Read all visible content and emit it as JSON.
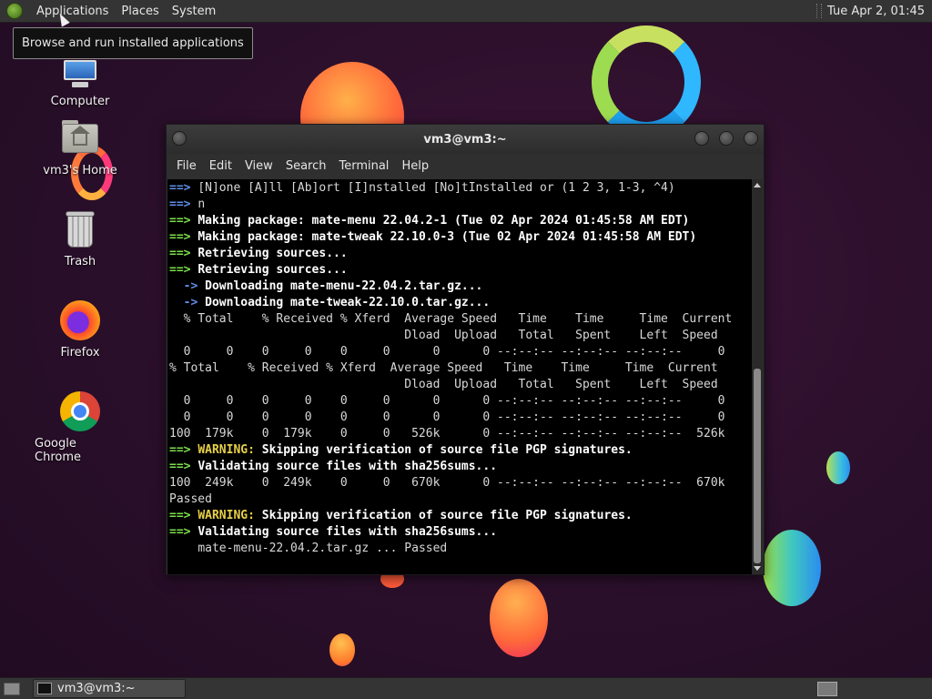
{
  "top_panel": {
    "menus": [
      "Applications",
      "Places",
      "System"
    ],
    "clock": "Tue Apr  2, 01:45",
    "logo_icon": "mate-logo-icon"
  },
  "tooltip": "Browse and run installed applications",
  "desktop_icons": [
    {
      "label": "Computer",
      "icon": "computer-icon"
    },
    {
      "label": "vm3's Home",
      "icon": "home-folder-icon"
    },
    {
      "label": "Trash",
      "icon": "trash-icon"
    },
    {
      "label": "Firefox",
      "icon": "firefox-icon"
    },
    {
      "label": "Google Chrome",
      "icon": "chrome-icon"
    }
  ],
  "terminal": {
    "title": "vm3@vm3:~",
    "menu": [
      "File",
      "Edit",
      "View",
      "Search",
      "Terminal",
      "Help"
    ],
    "lines": [
      {
        "p": "==> ",
        "pc": "bl",
        "t": "[N]one [A]ll [Ab]ort [I]nstalled [No]tInstalled or (1 2 3, 1-3, ^4)",
        "tc": ""
      },
      {
        "p": "==> ",
        "pc": "bl",
        "t": "n",
        "tc": ""
      },
      {
        "p": "==> ",
        "pc": "g",
        "t": "Making package: mate-menu 22.04.2-1 (Tue 02 Apr 2024 01:45:58 AM EDT)",
        "tc": "w"
      },
      {
        "p": "==> ",
        "pc": "g",
        "t": "Making package: mate-tweak 22.10.0-3 (Tue 02 Apr 2024 01:45:58 AM EDT)",
        "tc": "w"
      },
      {
        "p": "==> ",
        "pc": "g",
        "t": "Retrieving sources...",
        "tc": "w"
      },
      {
        "p": "==> ",
        "pc": "g",
        "t": "Retrieving sources...",
        "tc": "w"
      },
      {
        "p": "  -> ",
        "pc": "bl",
        "t": "Downloading mate-menu-22.04.2.tar.gz...",
        "tc": "w"
      },
      {
        "p": "  -> ",
        "pc": "bl",
        "t": "Downloading mate-tweak-22.10.0.tar.gz...",
        "tc": "w"
      },
      {
        "p": "",
        "pc": "",
        "t": "  % Total    % Received % Xferd  Average Speed   Time    Time     Time  Current",
        "tc": ""
      },
      {
        "p": "",
        "pc": "",
        "t": "                                 Dload  Upload   Total   Spent    Left  Speed",
        "tc": ""
      },
      {
        "p": "",
        "pc": "",
        "t": "  0     0    0     0    0     0      0      0 --:--:-- --:--:-- --:--:--     0",
        "tc": ""
      },
      {
        "p": "",
        "pc": "",
        "t": "% Total    % Received % Xferd  Average Speed   Time    Time     Time  Current",
        "tc": ""
      },
      {
        "p": "",
        "pc": "",
        "t": "                                 Dload  Upload   Total   Spent    Left  Speed",
        "tc": ""
      },
      {
        "p": "",
        "pc": "",
        "t": "  0     0    0     0    0     0      0      0 --:--:-- --:--:-- --:--:--     0",
        "tc": ""
      },
      {
        "p": "",
        "pc": "",
        "t": "  0     0    0     0    0     0      0      0 --:--:-- --:--:-- --:--:--     0",
        "tc": ""
      },
      {
        "p": "",
        "pc": "",
        "t": "100  179k    0  179k    0     0   526k      0 --:--:-- --:--:-- --:--:--  526k",
        "tc": ""
      },
      {
        "p": "==> ",
        "pc": "g",
        "t": "WARNING: ",
        "tc": "y",
        "t2": "Skipping verification of source file PGP signatures.",
        "tc2": "w"
      },
      {
        "p": "==> ",
        "pc": "g",
        "t": "Validating source files with sha256sums...",
        "tc": "w"
      },
      {
        "p": "",
        "pc": "",
        "t": "100  249k    0  249k    0     0   670k      0 --:--:-- --:--:-- --:--:--  670k",
        "tc": ""
      },
      {
        "p": "",
        "pc": "",
        "t": "Passed",
        "tc": ""
      },
      {
        "p": "==> ",
        "pc": "g",
        "t": "WARNING: ",
        "tc": "y",
        "t2": "Skipping verification of source file PGP signatures.",
        "tc2": "w"
      },
      {
        "p": "==> ",
        "pc": "g",
        "t": "Validating source files with sha256sums...",
        "tc": "w"
      },
      {
        "p": "    ",
        "pc": "",
        "t": "mate-menu-22.04.2.tar.gz ... Passed",
        "tc": ""
      }
    ]
  },
  "bottom_panel": {
    "task_label": "vm3@vm3:~"
  },
  "colors": {
    "prompt_green": "#7ee04a",
    "prompt_blue": "#5f8fe8",
    "warning_yellow": "#e8d048",
    "panel_bg": "#343434"
  }
}
